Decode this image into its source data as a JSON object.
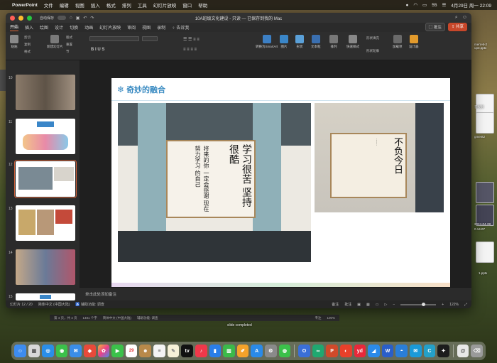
{
  "menubar": {
    "app_name": "PowerPoint",
    "items": [
      "文件",
      "编辑",
      "视图",
      "插入",
      "格式",
      "排列",
      "工具",
      "幻灯片放映",
      "窗口",
      "帮助"
    ],
    "battery": "55",
    "datetime": "4月29日 周一  22:09"
  },
  "window": {
    "autosave_label": "自动保存",
    "title": "10A班级文化建设 - 只读 — 已保存到我的 Mac",
    "tabs": [
      "开始",
      "插入",
      "绘图",
      "设计",
      "切换",
      "动画",
      "幻灯片放映",
      "审阅",
      "视图",
      "录制"
    ],
    "tell_me": "告诉我",
    "comment_label": "批注",
    "share_label": "共享"
  },
  "ribbon": {
    "paste": "粘贴",
    "cut": "剪切",
    "copy": "复制",
    "format": "格式",
    "new_slide": "新建幻灯片",
    "layout": "版式",
    "reset": "重置",
    "section": "节",
    "convert_smartart": "转换为SmartArt",
    "picture": "图片",
    "shapes": "形状",
    "textbox": "文本框",
    "arrange": "排列",
    "quick_styles": "快速样式",
    "shape_fill": "形状填充",
    "shape_outline": "形状轮廓",
    "addins": "加载项",
    "designer": "设计器"
  },
  "thumbnails": [
    {
      "num": "10"
    },
    {
      "num": "11"
    },
    {
      "num": "12"
    },
    {
      "num": "13"
    },
    {
      "num": "14"
    },
    {
      "num": "15"
    }
  ],
  "slide": {
    "title": "奇妙的融合",
    "calligraphy_left": "学习很苦\n坚持很酷",
    "calligraphy_mid": "将来的你\n一定会感谢\n现在努力学习\n的自己",
    "calligraphy_right": "不负今日"
  },
  "notes_placeholder": "单击此处添加备注",
  "status": {
    "slide_counter": "幻灯片 12 / 20",
    "language": "简体中文 (中国大陆)",
    "accessibility": "辅助功能: 调查",
    "notes_btn": "备注",
    "comments_btn": "批注",
    "zoom": "122%"
  },
  "word_status": {
    "page": "第 4 页，共 4 页",
    "words": "1481 个字",
    "language": "简体中文 (中国大陆)",
    "accessibility": "辅助功能: 调查",
    "focus": "专注",
    "zoom": "100%"
  },
  "slide_completed_text": "slide completed",
  "desktop_files": [
    {
      "label": "ment-6-2"
    },
    {
      "label": "up3.pptx"
    },
    {
      "label": "音视频"
    },
    {
      "label": "gment2"
    },
    {
      "label": "2024-04-28"
    },
    {
      "label": "0.14.07"
    },
    {
      "label": "1.pptx"
    }
  ]
}
